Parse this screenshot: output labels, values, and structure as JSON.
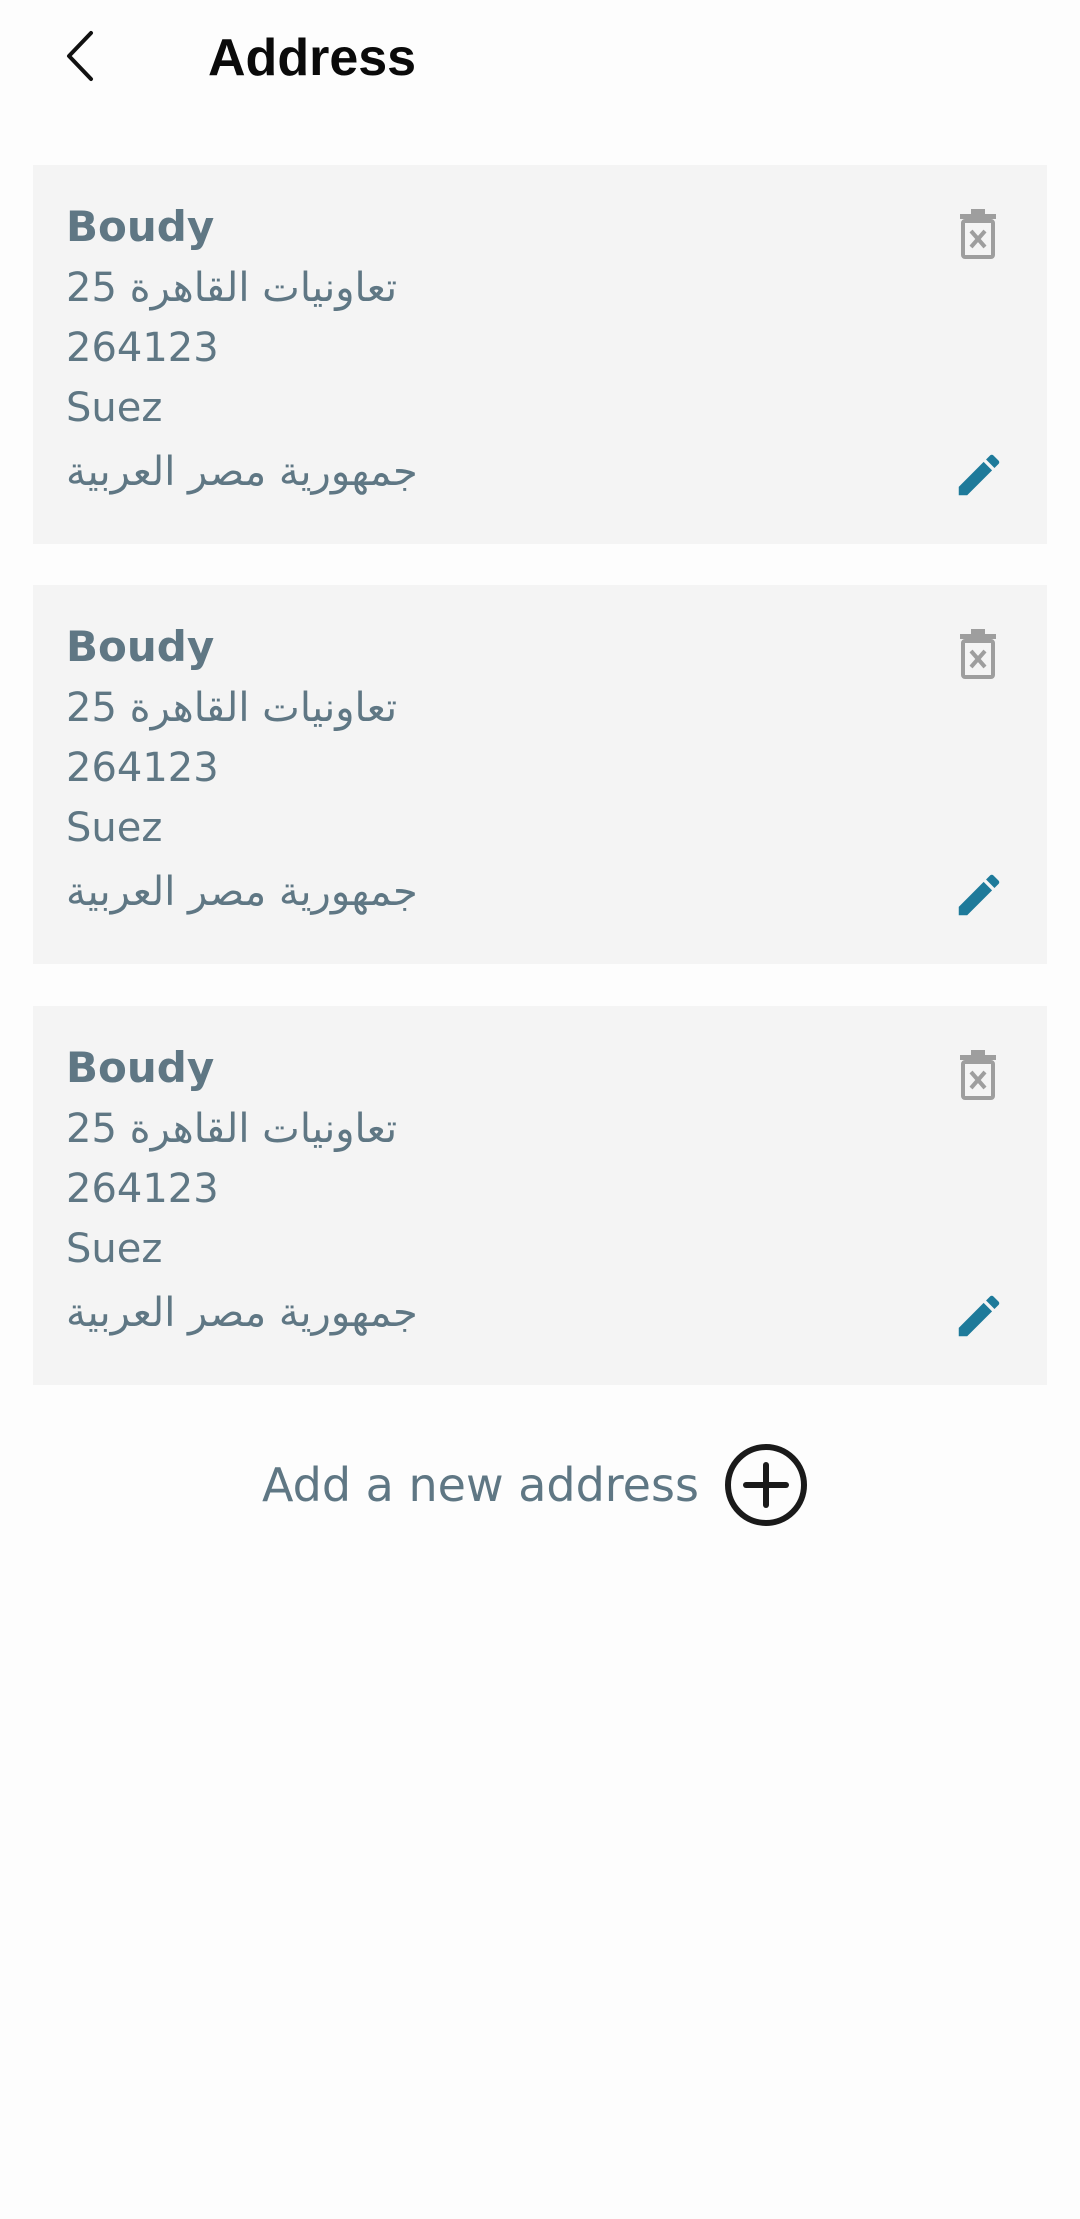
{
  "header": {
    "title": "Address",
    "back_icon": "chevron-left-icon"
  },
  "addresses": [
    {
      "name": "Boudy",
      "street": "تعاونيات القاهرة 25",
      "postal_code": "264123",
      "city": "Suez",
      "country": "جمهورية مصر العربية"
    },
    {
      "name": "Boudy",
      "street": "تعاونيات القاهرة 25",
      "postal_code": "264123",
      "city": "Suez",
      "country": "جمهورية مصر العربية"
    },
    {
      "name": "Boudy",
      "street": "تعاونيات القاهرة 25",
      "postal_code": "264123",
      "city": "Suez",
      "country": "جمهورية مصر العربية"
    }
  ],
  "actions": {
    "add_label": "Add a new address",
    "add_icon": "plus-circle-icon",
    "delete_icon": "trash-icon",
    "edit_icon": "pencil-icon"
  },
  "colors": {
    "text_secondary": "#5f7784",
    "accent_edit": "#1e7a9a",
    "delete_icon": "#9e9e9e",
    "card_bg": "#f4f4f4"
  }
}
